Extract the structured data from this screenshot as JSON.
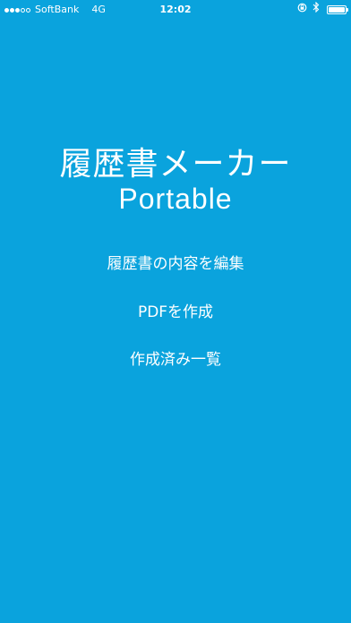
{
  "status_bar": {
    "carrier": "SoftBank",
    "network": "4G",
    "time": "12:02",
    "signal_bars_filled": 3,
    "signal_bars_total": 5,
    "icons": [
      "lock-rotation-icon",
      "bluetooth-icon",
      "battery-icon"
    ],
    "battery_level": 0.9
  },
  "title": {
    "main": "履歴書メーカー",
    "sub": "Portable"
  },
  "menu": {
    "edit_label": "履歴書の内容を編集",
    "pdf_label": "PDFを作成",
    "list_label": "作成済み一覧"
  },
  "colors": {
    "background": "#0aa3dd",
    "text": "#ffffff"
  }
}
